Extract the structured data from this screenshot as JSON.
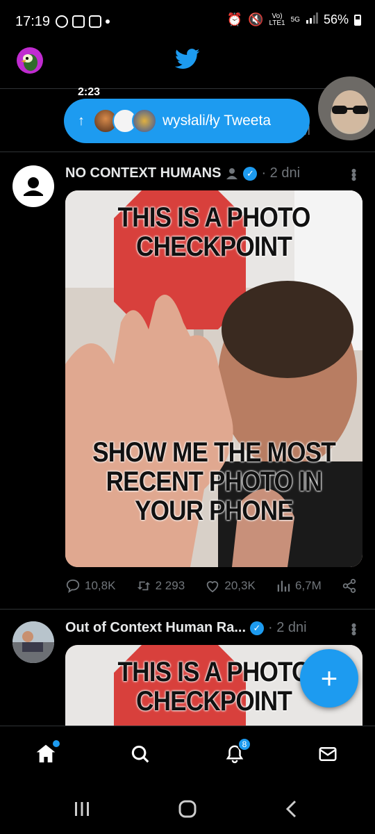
{
  "status_bar": {
    "time": "17:19",
    "network_label_top": "Vo)",
    "network_label_bottom": "LTE1",
    "network_type": "5G",
    "battery": "56%"
  },
  "peek": {
    "time": "2:23",
    "trailing": "M"
  },
  "new_tweets_pill": {
    "arrow": "↑",
    "label": "wysłali/ły Tweeta"
  },
  "tweets": [
    {
      "name": "NO CONTEXT HUMANS",
      "time": "· 2 dni",
      "meme_top_line1": "THIS IS A PHOTO",
      "meme_top_line2": "CHECKPOINT",
      "meme_bottom_line1": "SHOW ME THE MOST",
      "meme_bottom_line2": "RECENT PHOTO IN",
      "meme_bottom_line3": "YOUR PHONE",
      "replies": "10,8K",
      "retweets": "2 293",
      "likes": "20,3K",
      "views": "6,7M"
    },
    {
      "name": "Out of Context Human Ra...",
      "time": "· 2 dni",
      "meme_top_line1": "THIS IS A PHOTO",
      "meme_top_line2": "CHECKPOINT"
    }
  ],
  "bottom_nav": {
    "notifications_badge": "8"
  },
  "colors": {
    "accent": "#1d9bf0",
    "background": "#000000",
    "muted": "#71767b",
    "divider": "#2f3336"
  }
}
